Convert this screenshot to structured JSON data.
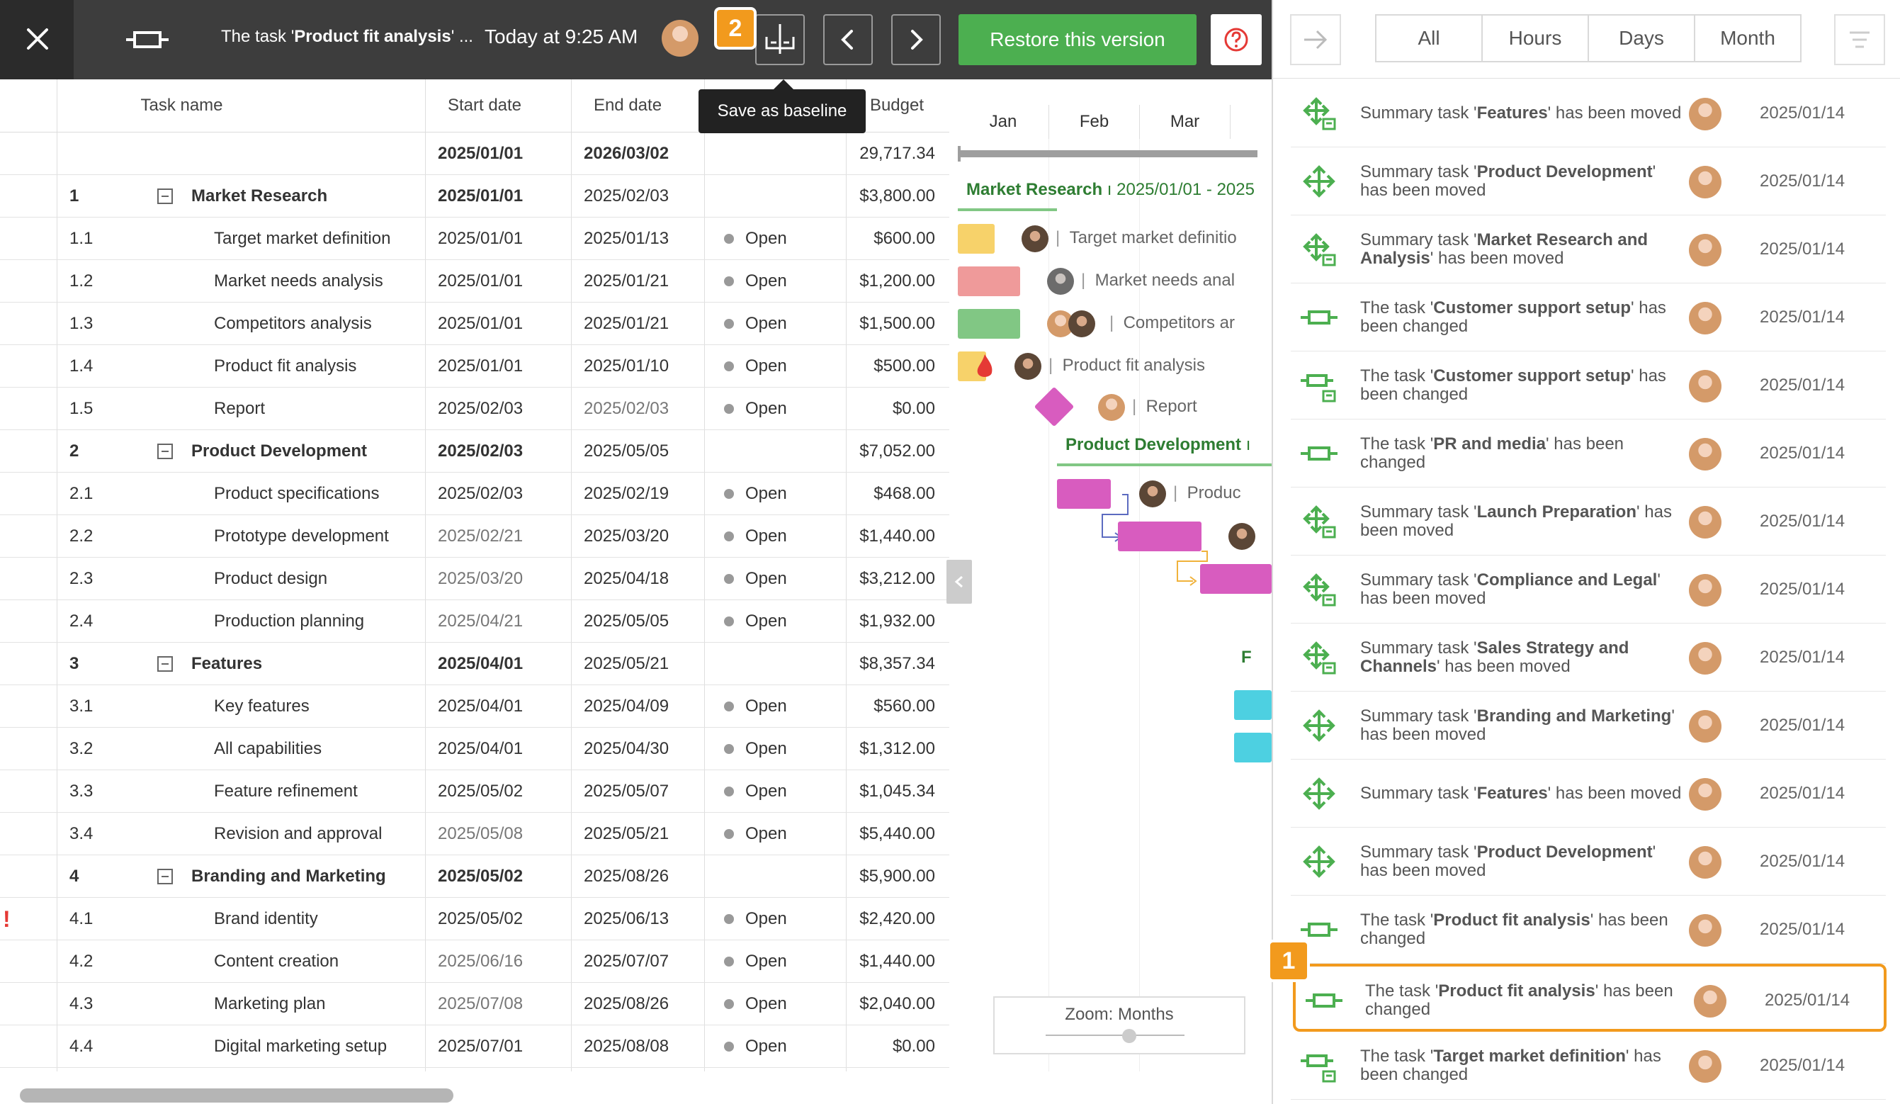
{
  "topbar": {
    "title_prefix": "The task '",
    "title_bold": "Product fit analysis",
    "title_suffix": "' ...",
    "timestamp": "Today at 9:25 AM",
    "restore_label": "Restore this version",
    "help_glyph": "?",
    "badge_2": "2",
    "tooltip": "Save as baseline"
  },
  "grid": {
    "headers": {
      "task_name": "Task name",
      "start_date": "Start date",
      "end_date": "End date",
      "budget": "Budget"
    },
    "summary": {
      "start": "2025/01/01",
      "end": "2026/03/02",
      "budget": "29,717.34"
    },
    "rows": [
      {
        "num": "1",
        "name": "Market Research",
        "start": "2025/01/01",
        "end": "2025/02/03",
        "status": "",
        "budget": "$3,800.00",
        "level": 0
      },
      {
        "num": "1.1",
        "name": "Target market definition",
        "start": "2025/01/01",
        "end": "2025/01/13",
        "status": "Open",
        "budget": "$600.00",
        "level": 1
      },
      {
        "num": "1.2",
        "name": "Market needs analysis",
        "start": "2025/01/01",
        "end": "2025/01/21",
        "status": "Open",
        "budget": "$1,200.00",
        "level": 1
      },
      {
        "num": "1.3",
        "name": "Competitors analysis",
        "start": "2025/01/01",
        "end": "2025/01/21",
        "status": "Open",
        "budget": "$1,500.00",
        "level": 1
      },
      {
        "num": "1.4",
        "name": "Product fit analysis",
        "start": "2025/01/01",
        "end": "2025/01/10",
        "status": "Open",
        "budget": "$500.00",
        "level": 1
      },
      {
        "num": "1.5",
        "name": "Report",
        "start": "2025/02/03",
        "end": "2025/02/03",
        "status": "Open",
        "budget": "$0.00",
        "level": 1,
        "end_gray": true
      },
      {
        "num": "2",
        "name": "Product Development",
        "start": "2025/02/03",
        "end": "2025/05/05",
        "status": "",
        "budget": "$7,052.00",
        "level": 0
      },
      {
        "num": "2.1",
        "name": "Product specifications",
        "start": "2025/02/03",
        "end": "2025/02/19",
        "status": "Open",
        "budget": "$468.00",
        "level": 1
      },
      {
        "num": "2.2",
        "name": "Prototype development",
        "start": "2025/02/21",
        "end": "2025/03/20",
        "status": "Open",
        "budget": "$1,440.00",
        "level": 1,
        "start_gray": true
      },
      {
        "num": "2.3",
        "name": "Product design",
        "start": "2025/03/20",
        "end": "2025/04/18",
        "status": "Open",
        "budget": "$3,212.00",
        "level": 1,
        "start_gray": true
      },
      {
        "num": "2.4",
        "name": "Production planning",
        "start": "2025/04/21",
        "end": "2025/05/05",
        "status": "Open",
        "budget": "$1,932.00",
        "level": 1,
        "start_gray": true
      },
      {
        "num": "3",
        "name": "Features",
        "start": "2025/04/01",
        "end": "2025/05/21",
        "status": "",
        "budget": "$8,357.34",
        "level": 0
      },
      {
        "num": "3.1",
        "name": "Key features",
        "start": "2025/04/01",
        "end": "2025/04/09",
        "status": "Open",
        "budget": "$560.00",
        "level": 1
      },
      {
        "num": "3.2",
        "name": "All capabilities",
        "start": "2025/04/01",
        "end": "2025/04/30",
        "status": "Open",
        "budget": "$1,312.00",
        "level": 1
      },
      {
        "num": "3.3",
        "name": "Feature refinement",
        "start": "2025/05/02",
        "end": "2025/05/07",
        "status": "Open",
        "budget": "$1,045.34",
        "level": 1
      },
      {
        "num": "3.4",
        "name": "Revision and approval",
        "start": "2025/05/08",
        "end": "2025/05/21",
        "status": "Open",
        "budget": "$5,440.00",
        "level": 1,
        "start_gray": true
      },
      {
        "num": "4",
        "name": "Branding and Marketing",
        "start": "2025/05/02",
        "end": "2025/08/26",
        "status": "",
        "budget": "$5,900.00",
        "level": 0
      },
      {
        "num": "4.1",
        "name": "Brand identity",
        "start": "2025/05/02",
        "end": "2025/06/13",
        "status": "Open",
        "budget": "$2,420.00",
        "level": 1,
        "flag": "!"
      },
      {
        "num": "4.2",
        "name": "Content creation",
        "start": "2025/06/16",
        "end": "2025/07/07",
        "status": "Open",
        "budget": "$1,440.00",
        "level": 1,
        "start_gray": true
      },
      {
        "num": "4.3",
        "name": "Marketing plan",
        "start": "2025/07/08",
        "end": "2025/08/26",
        "status": "Open",
        "budget": "$2,040.00",
        "level": 1,
        "start_gray": true
      },
      {
        "num": "4.4",
        "name": "Digital marketing setup",
        "start": "2025/07/01",
        "end": "2025/08/08",
        "status": "Open",
        "budget": "$0.00",
        "level": 1
      }
    ]
  },
  "gantt": {
    "months": [
      "Jan",
      "Feb",
      "Mar"
    ],
    "group1_label": "Market Research",
    "group1_dates": "2025/01/01 - 2025",
    "group2_label": "Product Development",
    "group3_label": "F",
    "labels": {
      "t11": "Target market definitio",
      "t12": "Market needs anal",
      "t13": "Competitors ar",
      "t14": "Product fit analysis",
      "t15": "Report",
      "t21": "Produc"
    },
    "zoom_label": "Zoom: Months",
    "colors": {
      "yellow": "#f7d26a",
      "red": "#ef9a9a",
      "green": "#81c784",
      "magenta": "#d85cbf",
      "cyan": "#4dd0e1",
      "groupgreen": "#2e7d32"
    }
  },
  "panel": {
    "tabs": [
      "All",
      "Hours",
      "Days",
      "Month"
    ],
    "badge_1": "1",
    "items": [
      {
        "kind": "Summary task '",
        "bold": "Features",
        "rest": "' has been moved",
        "date": "2025/01/14",
        "icon": "move-baseline-icon"
      },
      {
        "kind": "Summary task '",
        "bold": "Product Development",
        "rest": "' has been moved",
        "date": "2025/01/14",
        "icon": "move-icon"
      },
      {
        "kind": "Summary task '",
        "bold": "Market Research and Analysis",
        "rest": "' has been moved",
        "date": "2025/01/14",
        "icon": "move-baseline-icon"
      },
      {
        "kind": "The task '",
        "bold": "Customer support setup",
        "rest": "' has been changed",
        "date": "2025/01/14",
        "icon": "task-icon"
      },
      {
        "kind": "The task '",
        "bold": "Customer support setup",
        "rest": "' has been changed",
        "date": "2025/01/14",
        "icon": "task-baseline-icon"
      },
      {
        "kind": "The task '",
        "bold": "PR and media",
        "rest": "' has been changed",
        "date": "2025/01/14",
        "icon": "task-icon"
      },
      {
        "kind": "Summary task '",
        "bold": "Launch Preparation",
        "rest": "' has been moved",
        "date": "2025/01/14",
        "icon": "move-baseline-icon"
      },
      {
        "kind": "Summary task '",
        "bold": "Compliance and Legal",
        "rest": "' has been moved",
        "date": "2025/01/14",
        "icon": "move-baseline-icon"
      },
      {
        "kind": "Summary task '",
        "bold": "Sales Strategy and Channels",
        "rest": "' has been moved",
        "date": "2025/01/14",
        "icon": "move-baseline-icon"
      },
      {
        "kind": "Summary task '",
        "bold": "Branding and Marketing",
        "rest": "' has been moved",
        "date": "2025/01/14",
        "icon": "move-icon"
      },
      {
        "kind": "Summary task '",
        "bold": "Features",
        "rest": "' has been moved",
        "date": "2025/01/14",
        "icon": "move-icon"
      },
      {
        "kind": "Summary task '",
        "bold": "Product Development",
        "rest": "' has been moved",
        "date": "2025/01/14",
        "icon": "move-icon"
      },
      {
        "kind": "The task '",
        "bold": "Product fit analysis",
        "rest": "' has been changed",
        "date": "2025/01/14",
        "icon": "task-icon"
      },
      {
        "kind": "The task '",
        "bold": "Product fit analysis",
        "rest": "' has been changed",
        "date": "2025/01/14",
        "icon": "task-icon",
        "selected": true
      },
      {
        "kind": "The task '",
        "bold": "Target market definition",
        "rest": "' has been changed",
        "date": "2025/01/14",
        "icon": "task-baseline-icon"
      }
    ]
  }
}
